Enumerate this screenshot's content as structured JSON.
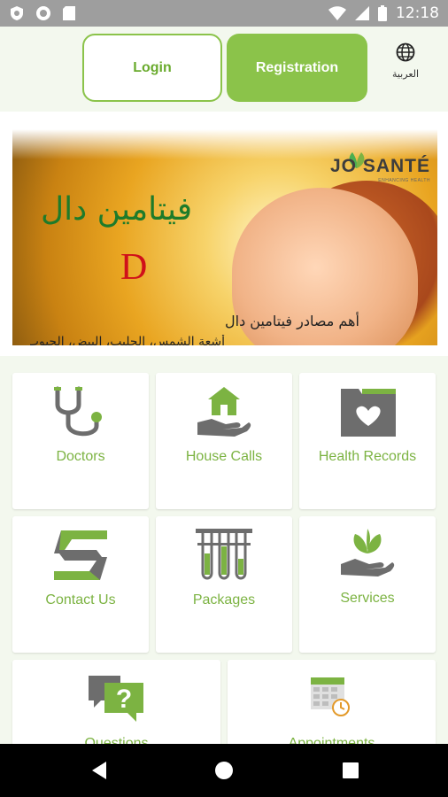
{
  "status_bar": {
    "time": "12:18",
    "icons_left": [
      "shield-icon",
      "record-icon",
      "sd-card-icon"
    ],
    "icons_right": [
      "wifi-icon",
      "cell-signal-icon",
      "battery-icon"
    ]
  },
  "header": {
    "login_label": "Login",
    "registration_label": "Registration",
    "language_label": "العربية",
    "language_icon": "globe-icon"
  },
  "banner": {
    "logo_text": "JO SANTÉ",
    "logo_subtext": "ENHANCING HEALTH",
    "title": "فيتامين دال",
    "letter": "D",
    "line1": "أهم مصادر فيتامين دال",
    "line2": "أشعة الشمس، الحليب، البيض، الحبوب"
  },
  "grid": {
    "accent": "#7cb342",
    "tiles": [
      {
        "label": "Doctors",
        "icon": "stethoscope-icon"
      },
      {
        "label": "House Calls",
        "icon": "house-hand-icon"
      },
      {
        "label": "Health Records",
        "icon": "folder-heart-icon"
      },
      {
        "label": "Contact Us",
        "icon": "contact-logo-icon"
      },
      {
        "label": "Packages",
        "icon": "test-tubes-icon"
      },
      {
        "label": "Services",
        "icon": "leaf-hand-icon"
      },
      {
        "label": "Questions",
        "icon": "question-bubble-icon"
      },
      {
        "label": "Appointments",
        "icon": "calendar-clock-icon"
      }
    ]
  },
  "nav_bar": {
    "icons": [
      "back-icon",
      "home-icon",
      "recents-icon"
    ]
  }
}
